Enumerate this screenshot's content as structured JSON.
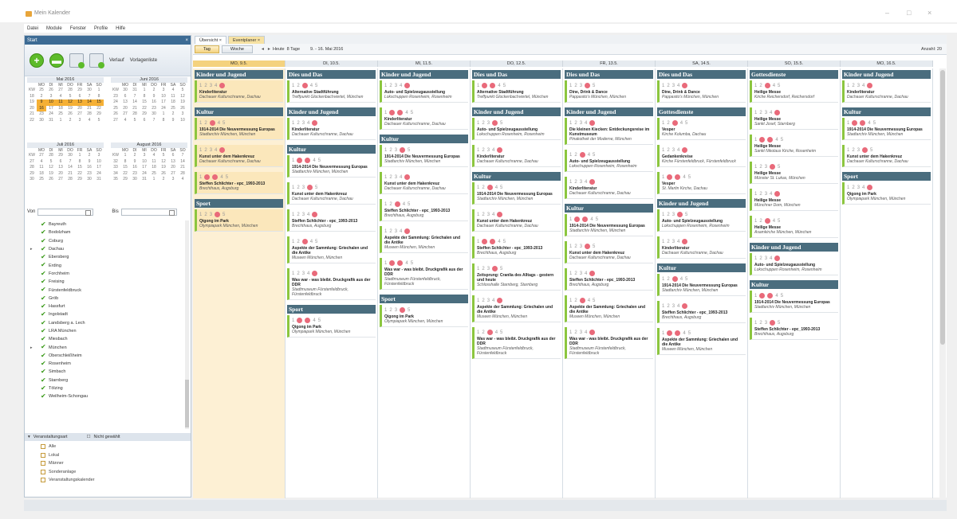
{
  "window": {
    "title": "Mein Kalender",
    "min": "–",
    "max": "□",
    "close": "×"
  },
  "menu": [
    "Datei",
    "Module",
    "Fenster",
    "Profile",
    "Hilfe"
  ],
  "left_panel": {
    "title": "Start",
    "toolbar": {
      "verlauf": "Verlauf",
      "vorlagenliste": "Vorlagenliste"
    },
    "calendars": [
      {
        "title": "Mai 2016",
        "days": [
          "MO",
          "DI",
          "MI",
          "DO",
          "FR",
          "SA",
          "SO"
        ],
        "weeks": [
          [
            "KW",
            "25",
            "26",
            "27",
            "28",
            "29",
            "30",
            "1"
          ],
          [
            "18",
            "2",
            "3",
            "4",
            "5",
            "6",
            "7",
            "8"
          ],
          [
            "19",
            "9",
            "10",
            "11",
            "12",
            "13",
            "14",
            "15"
          ],
          [
            "20",
            "16",
            "17",
            "18",
            "19",
            "20",
            "21",
            "22"
          ],
          [
            "21",
            "23",
            "24",
            "25",
            "26",
            "27",
            "28",
            "29"
          ],
          [
            "22",
            "30",
            "31",
            "1",
            "2",
            "3",
            "4",
            "5"
          ]
        ]
      },
      {
        "title": "Juni 2016",
        "days": [
          "MO",
          "DI",
          "MI",
          "DO",
          "FR",
          "SA",
          "SO"
        ],
        "weeks": [
          [
            "KW",
            "30",
            "31",
            "1",
            "2",
            "3",
            "4",
            "5"
          ],
          [
            "23",
            "6",
            "7",
            "8",
            "9",
            "10",
            "11",
            "12"
          ],
          [
            "24",
            "13",
            "14",
            "15",
            "16",
            "17",
            "18",
            "19"
          ],
          [
            "25",
            "20",
            "21",
            "22",
            "23",
            "24",
            "25",
            "26"
          ],
          [
            "26",
            "27",
            "28",
            "29",
            "30",
            "1",
            "2",
            "3"
          ],
          [
            "27",
            "4",
            "5",
            "6",
            "7",
            "8",
            "9",
            "10"
          ]
        ]
      },
      {
        "title": "Juli 2016",
        "days": [
          "MO",
          "DI",
          "MI",
          "DO",
          "FR",
          "SA",
          "SO"
        ],
        "weeks": [
          [
            "KW",
            "27",
            "28",
            "29",
            "30",
            "1",
            "2",
            "3"
          ],
          [
            "27",
            "4",
            "5",
            "6",
            "7",
            "8",
            "9",
            "10"
          ],
          [
            "28",
            "11",
            "12",
            "13",
            "14",
            "15",
            "16",
            "17"
          ],
          [
            "29",
            "18",
            "19",
            "20",
            "21",
            "22",
            "23",
            "24"
          ],
          [
            "30",
            "25",
            "26",
            "27",
            "28",
            "29",
            "30",
            "31"
          ]
        ]
      },
      {
        "title": "August 2016",
        "days": [
          "MO",
          "DI",
          "MI",
          "DO",
          "FR",
          "SA",
          "SO"
        ],
        "weeks": [
          [
            "KW",
            "1",
            "2",
            "3",
            "4",
            "5",
            "6",
            "7"
          ],
          [
            "32",
            "8",
            "9",
            "10",
            "11",
            "12",
            "13",
            "14"
          ],
          [
            "33",
            "15",
            "16",
            "17",
            "18",
            "19",
            "20",
            "21"
          ],
          [
            "34",
            "22",
            "23",
            "24",
            "25",
            "26",
            "27",
            "28"
          ],
          [
            "35",
            "29",
            "30",
            "31",
            "1",
            "2",
            "3",
            "4"
          ]
        ]
      }
    ],
    "range": {
      "von": "Von",
      "bis": "Bis"
    },
    "locations": [
      "Bayreuth",
      "Bodolzham",
      "Coburg",
      "Dachau",
      "Ebersberg",
      "Erding",
      "Forchheim",
      "Freising",
      "Fürstenfeldbruck",
      "Gröb",
      "Hassfurt",
      "Ingolstadt",
      "Landsberg a. Lech",
      "LRA München",
      "Miesbach",
      "München",
      "Oberschleißheim",
      "Rosenheim",
      "Simbach",
      "Starnberg",
      "Tölzing",
      "Weilheim-Schongau"
    ],
    "filter": {
      "header": "Veranstaltungsart",
      "sub": "Nicht gewählt",
      "items": [
        "Alle",
        "Lokal",
        "Männer",
        "Sonderanlage",
        "Veranstaltungskalender"
      ]
    }
  },
  "main": {
    "tabs": [
      "Übersicht",
      "Eventplaner"
    ],
    "views": {
      "tag": "Tag",
      "woche": "Woche"
    },
    "nav": {
      "heute": "Heute",
      "range_label": "8 Tage",
      "range": "9. - 16. Mai 2016"
    },
    "right_label": "Anzahl: 20",
    "days": [
      "MO, 9.5.",
      "DI, 10.5.",
      "MI, 11.5.",
      "DO, 12.5.",
      "FR, 13.5.",
      "SA, 14.5.",
      "SO, 15.5.",
      "MO, 16.5."
    ],
    "columns": [
      {
        "blocks": [
          {
            "cat": "Kinder und Jugend",
            "cards": [
              {
                "title": "Kinderliteratur",
                "loc": "Dachauer Kulturschranne, Dachau"
              }
            ]
          },
          {
            "cat": "Kultur",
            "cards": [
              {
                "title": "1914-2014 Die Neuvermessung Europas",
                "loc": "Stadtarchiv München, München"
              },
              {
                "title": "Kunst unter dem Hakenkreuz",
                "loc": "Dachauer Kulturschranne, Dachau"
              },
              {
                "title": "Steffen Schlichter - epc_1993-2013",
                "loc": "Brechthaus, Augsburg"
              }
            ]
          },
          {
            "cat": "Sport",
            "cards": [
              {
                "title": "Qigong im Park",
                "loc": "Olympiapark München, München"
              }
            ]
          }
        ]
      },
      {
        "blocks": [
          {
            "cat": "Dies und Das",
            "cards": [
              {
                "title": "Alternative Stadtführung",
                "loc": "Treffpunkt Glockenbachviertel, München"
              }
            ]
          },
          {
            "cat": "Kinder und Jugend",
            "cards": [
              {
                "title": "Kinderliteratur",
                "loc": "Dachauer Kulturschranne, Dachau"
              }
            ]
          },
          {
            "cat": "Kultur",
            "cards": [
              {
                "title": "1914-2014 Die Neuvermessung Europas",
                "loc": "Stadtarchiv München, München"
              },
              {
                "title": "Kunst unter dem Hakenkreuz",
                "loc": "Dachauer Kulturschranne, Dachau"
              },
              {
                "title": "Steffen Schlichter - epc_1993-2013",
                "loc": "Brechthaus, Augsburg"
              },
              {
                "title": "Aspekte der Sammlung: Griechalen und die Antike",
                "loc": "Museen München, München"
              },
              {
                "title": "Was war - was bleibt. Druckgrafik aus der DDR",
                "loc": "Stadtmuseum Fürstenfeldbruck, Fürstenfeldbruck"
              }
            ]
          },
          {
            "cat": "Sport",
            "cards": [
              {
                "title": "Qigong im Park",
                "loc": "Olympiapark München, München"
              }
            ]
          }
        ]
      },
      {
        "blocks": [
          {
            "cat": "Kinder und Jugend",
            "cards": [
              {
                "title": "Auto- und Spielzeugausstellung",
                "loc": "Lokschuppen Rosenheim, Rosenheim"
              },
              {
                "title": "Kinderliteratur",
                "loc": "Dachauer Kulturschranne, Dachau"
              }
            ]
          },
          {
            "cat": "Kultur",
            "cards": [
              {
                "title": "1914-2014 Die Neuvermessung Europas",
                "loc": "Stadtarchiv München, München"
              },
              {
                "title": "Kunst unter dem Hakenkreuz",
                "loc": "Dachauer Kulturschranne, Dachau"
              },
              {
                "title": "Steffen Schlichter - epc_1993-2013",
                "loc": "Brechthaus, Augsburg"
              },
              {
                "title": "Aspekte der Sammlung: Griechalen und die Antike",
                "loc": "Museen München, München"
              },
              {
                "title": "Was war - was bleibt. Druckgrafik aus der DDR",
                "loc": "Stadtmuseum Fürstenfeldbruck, Fürstenfeldbruck"
              }
            ]
          },
          {
            "cat": "Sport",
            "cards": [
              {
                "title": "Qigong im Park",
                "loc": "Olympiapark München, München"
              }
            ]
          }
        ]
      },
      {
        "blocks": [
          {
            "cat": "Dies und Das",
            "cards": [
              {
                "title": "Alternative Stadtführung",
                "loc": "Treffpunkt Glockenbachviertel, München"
              }
            ]
          },
          {
            "cat": "Kinder und Jugend",
            "cards": [
              {
                "title": "Auto- und Spielzeugausstellung",
                "loc": "Lokschuppen Rosenheim, Rosenheim"
              },
              {
                "title": "Kinderliteratur",
                "loc": "Dachauer Kulturschranne, Dachau"
              }
            ]
          },
          {
            "cat": "Kultur",
            "cards": [
              {
                "title": "1914-2014 Die Neuvermessung Europas",
                "loc": "Stadtarchiv München, München"
              },
              {
                "title": "Kunst unter dem Hakenkreuz",
                "loc": "Dachauer Kulturschranne, Dachau"
              },
              {
                "title": "Steffen Schlichter - epc_1993-2013",
                "loc": "Brechthaus, Augsburg"
              },
              {
                "title": "Zeitsprung: Cranlia des Alltags - gestern und heute",
                "loc": "Schlosshalle Starnberg, Starnberg"
              },
              {
                "title": "Aspekte der Sammlung: Griechalen und die Antike",
                "loc": "Museen München, München"
              },
              {
                "title": "Was war - was bleibt. Druckgrafik aus der DDR",
                "loc": "Stadtmuseum Fürstenfeldbruck, Fürstenfeldbruck"
              }
            ]
          }
        ]
      },
      {
        "blocks": [
          {
            "cat": "Dies und Das",
            "cards": [
              {
                "title": "Dine, Drink & Dance",
                "loc": "Pappasito's München, München"
              }
            ]
          },
          {
            "cat": "Kinder und Jugend",
            "cards": [
              {
                "title": "Die kleinen Kiecken: Entdeckungsreise im Kunstmuseum",
                "loc": "Pinakothek der Moderne, München"
              },
              {
                "title": "Auto- und Spielzeugausstellung",
                "loc": "Lokschuppen Rosenheim, Rosenheim"
              },
              {
                "title": "Kinderliteratur",
                "loc": "Dachauer Kulturschranne, Dachau"
              }
            ]
          },
          {
            "cat": "Kultur",
            "cards": [
              {
                "title": "1914-2014 Die Neuvermessung Europas",
                "loc": "Stadtarchiv München, München"
              },
              {
                "title": "Kunst unter dem Hakenkreuz",
                "loc": "Dachauer Kulturschranne, Dachau"
              },
              {
                "title": "Steffen Schlichter - epc_1993-2013",
                "loc": "Brechthaus, Augsburg"
              },
              {
                "title": "Aspekte der Sammlung: Griechalen und die Antike",
                "loc": "Museen München, München"
              },
              {
                "title": "Was war - was bleibt. Druckgrafik aus der DDR",
                "loc": "Stadtmuseum Fürstenfeldbruck, Fürstenfeldbruck"
              }
            ]
          }
        ]
      },
      {
        "blocks": [
          {
            "cat": "Dies und Das",
            "cards": [
              {
                "title": "Dine, Drink & Dance",
                "loc": "Pappasito's München, München"
              }
            ]
          },
          {
            "cat": "Gottesdienste",
            "cards": [
              {
                "title": "Vesper",
                "loc": "Kirche Kolumba, Dachau"
              },
              {
                "title": "Gedankenkreise",
                "loc": "Kirche Fürstenfeldbruck, Fürstenfeldbruck"
              },
              {
                "title": "Vesper",
                "loc": "St. Martin Kirche, Dachau"
              }
            ]
          },
          {
            "cat": "Kinder und Jugend",
            "cards": [
              {
                "title": "Auto- und Spielzeugausstellung",
                "loc": "Lokschuppen Rosenheim, Rosenheim"
              },
              {
                "title": "Kinderliteratur",
                "loc": "Dachauer Kulturschranne, Dachau"
              }
            ]
          },
          {
            "cat": "Kultur",
            "cards": [
              {
                "title": "1914-2014 Die Neuvermessung Europas",
                "loc": "Stadtarchiv München, München"
              },
              {
                "title": "Steffen Schlichter - epc_1993-2013",
                "loc": "Brechthaus, Augsburg"
              },
              {
                "title": "Aspekte der Sammlung: Griechalen und die Antike",
                "loc": "Museen München, München"
              }
            ]
          }
        ]
      },
      {
        "blocks": [
          {
            "cat": "Gottesdienste",
            "cards": [
              {
                "title": "Heilige Messe",
                "loc": "Kirche Reichersdorf, Reichersdorf"
              },
              {
                "title": "Heilige Messe",
                "loc": "Sankt Josef, Starnberg"
              },
              {
                "title": "Heilige Messe",
                "loc": "Sankt Nikolaus Kirche, Rosenheim"
              },
              {
                "title": "Heilige Messe",
                "loc": "Münster St. Lukas, München"
              },
              {
                "title": "Heilige Messe",
                "loc": "Münchner Dom, München"
              },
              {
                "title": "Heilige Messe",
                "loc": "Asamkirche München, München"
              }
            ]
          },
          {
            "cat": "Kinder und Jugend",
            "cards": [
              {
                "title": "Auto- und Spielzeugausstellung",
                "loc": "Lokschuppen Rosenheim, Rosenheim"
              }
            ]
          },
          {
            "cat": "Kultur",
            "cards": [
              {
                "title": "1914-2014 Die Neuvermessung Europas",
                "loc": "Stadtarchiv München, München"
              },
              {
                "title": "Steffen Schlichter - epc_1993-2013",
                "loc": "Brechthaus, Augsburg"
              }
            ]
          }
        ]
      },
      {
        "blocks": [
          {
            "cat": "Kinder und Jugend",
            "cards": [
              {
                "title": "Kinderliteratur",
                "loc": "Dachauer Kulturschranne, Dachau"
              }
            ]
          },
          {
            "cat": "Kultur",
            "cards": [
              {
                "title": "1914-2014 Die Neuvermessung Europas",
                "loc": "Stadtarchiv München, München"
              },
              {
                "title": "Kunst unter dem Hakenkreuz",
                "loc": "Dachauer Kulturschranne, Dachau"
              }
            ]
          },
          {
            "cat": "Sport",
            "cards": [
              {
                "title": "Qigong im Park",
                "loc": "Olympiapark München, München"
              }
            ]
          }
        ]
      }
    ]
  }
}
